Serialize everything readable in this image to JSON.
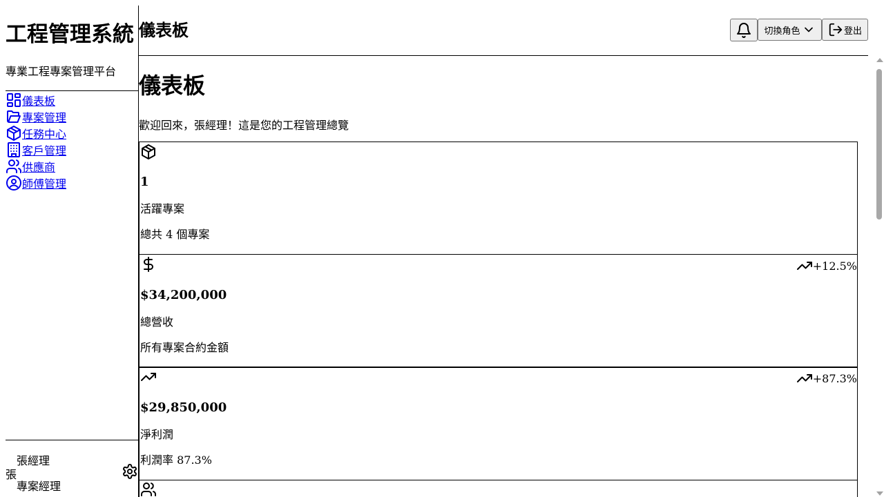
{
  "app": {
    "title": "工程管理系統",
    "subtitle": "專業工程專案管理平台"
  },
  "nav": [
    {
      "label": "儀表板",
      "icon": "dashboard-grid-icon"
    },
    {
      "label": "專案管理",
      "icon": "folder-icon"
    },
    {
      "label": "任務中心",
      "icon": "box-icon"
    },
    {
      "label": "客戶管理",
      "icon": "building-icon"
    },
    {
      "label": "供應商",
      "icon": "users-icon"
    },
    {
      "label": "師傅管理",
      "icon": "user-circle-icon"
    }
  ],
  "user": {
    "initial": "張",
    "name": "張經理",
    "role": "專案經理"
  },
  "topbar": {
    "title": "儀表板",
    "role_switch_label": "切換角色",
    "logout_label": "登出"
  },
  "main": {
    "heading": "儀表板",
    "welcome": "歡迎回來，張經理！這是您的工程管理總覽"
  },
  "cards": [
    {
      "icon": "box-icon",
      "value": "1",
      "label": "活躍專案",
      "sub": "總共 4 個專案",
      "trend": ""
    },
    {
      "icon": "dollar-icon",
      "value": "$34,200,000",
      "label": "總營收",
      "sub": "所有專案合約金額",
      "trend": "+12.5%"
    },
    {
      "icon": "trending-up-icon",
      "value": "$29,850,000",
      "label": "淨利潤",
      "sub": "利潤率 87.3%",
      "trend": "+87.3%"
    },
    {
      "icon": "users-icon",
      "value": "",
      "label": "",
      "sub": "",
      "trend": ""
    }
  ]
}
